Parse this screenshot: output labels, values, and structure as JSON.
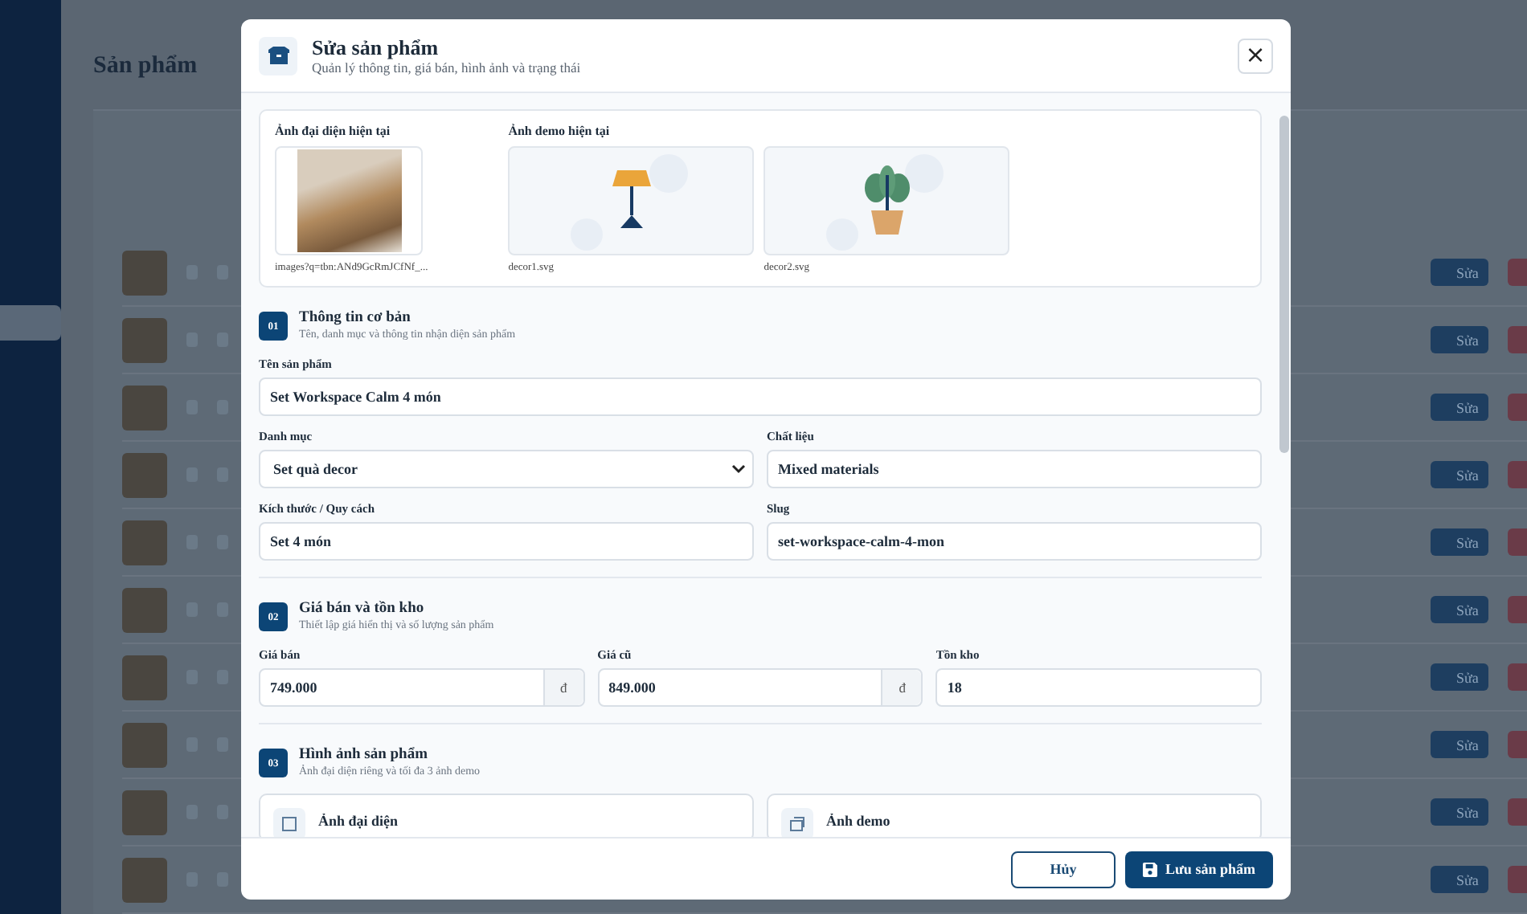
{
  "background": {
    "page_title": "Sản phẩm",
    "edit_buttons": [
      "Sửa",
      "Sửa",
      "Sửa",
      "Sửa",
      "Sửa",
      "Sửa",
      "Sửa",
      "Sửa",
      "Sửa",
      "Sửa"
    ]
  },
  "modal": {
    "title": "Sửa sản phẩm",
    "subtitle": "Quản lý thông tin, giá bán, hình ảnh và trạng thái",
    "close": "×",
    "current_images": {
      "avatar_label": "Ảnh đại diện hiện tại",
      "avatar_file": "images?q=tbn:ANd9GcRmJCfNf_...",
      "demo_label": "Ảnh demo hiện tại",
      "demos": [
        {
          "file": "decor1.svg",
          "kind": "lamp"
        },
        {
          "file": "decor2.svg",
          "kind": "plant"
        }
      ]
    },
    "sections": [
      {
        "number": "01",
        "title": "Thông tin cơ bản",
        "subtitle": "Tên, danh mục và thông tin nhận diện sản phẩm",
        "fields": [
          {
            "label": "Tên sản phẩm",
            "value": "Set Workspace Calm 4 món",
            "kind": "text"
          },
          {
            "label": "Danh mục",
            "value": "Set quà decor",
            "kind": "select"
          },
          {
            "label": "Chất liệu",
            "value": "Mixed materials",
            "kind": "text"
          },
          {
            "label": "Kích thước / Quy cách",
            "value": "Set 4 món",
            "kind": "text"
          },
          {
            "label": "Slug",
            "value": "set-workspace-calm-4-mon",
            "kind": "text"
          }
        ]
      },
      {
        "number": "02",
        "title": "Giá bán và tồn kho",
        "subtitle": "Thiết lập giá hiển thị và số lượng sản phẩm",
        "fields": [
          {
            "label": "Giá bán",
            "value": "749.000",
            "kind": "currency",
            "suffix": "đ"
          },
          {
            "label": "Giá cũ",
            "value": "849.000",
            "kind": "currency",
            "suffix": "đ"
          },
          {
            "label": "Tồn kho",
            "value": "18",
            "kind": "text"
          }
        ]
      },
      {
        "number": "03",
        "title": "Hình ảnh sản phẩm",
        "subtitle": "Ảnh đại diện riêng và tối đa 3 ảnh demo",
        "uploads": [
          {
            "label": "Ảnh đại diện",
            "kind": "single"
          },
          {
            "label": "Ảnh demo",
            "kind": "multi"
          }
        ]
      }
    ],
    "buttons": [
      {
        "label": "Hủy",
        "kind": "secondary"
      },
      {
        "label": "Lưu sản phẩm",
        "kind": "primary"
      }
    ]
  }
}
